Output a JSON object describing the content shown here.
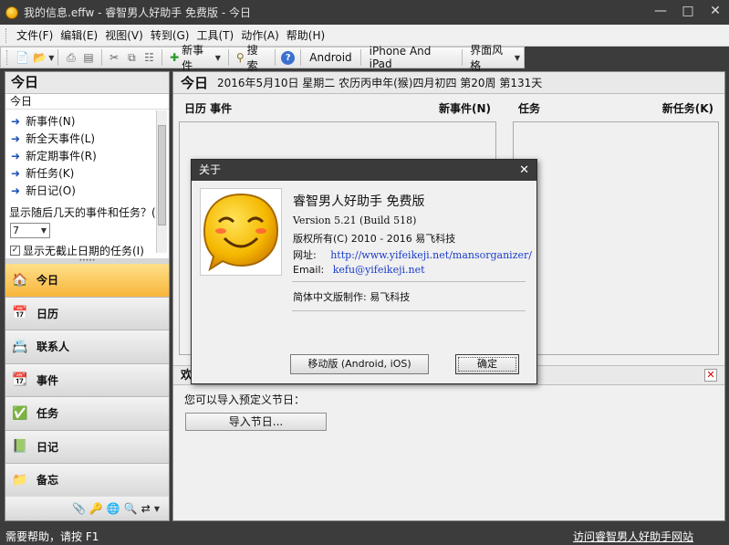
{
  "window": {
    "title": "我的信息.effw - 睿智男人好助手 免费版 - 今日"
  },
  "menu": [
    "文件(F)",
    "编辑(E)",
    "视图(V)",
    "转到(G)",
    "工具(T)",
    "动作(A)",
    "帮助(H)"
  ],
  "toolbar": {
    "new_event": "新事件",
    "search": "搜索",
    "android": "Android",
    "iphone": "iPhone And iPad",
    "theme": "界面风格"
  },
  "left": {
    "header": "今日",
    "sub": "今日",
    "links": [
      "新事件(N)",
      "新全天事件(L)",
      "新定期事件(R)",
      "新任务(K)",
      "新日记(O)"
    ],
    "days_label": "显示随后几天的事件和任务？(S)",
    "days_value": "7",
    "show_overdue": "显示无截止日期的任务(I)",
    "nav": [
      "今日",
      "日历",
      "联系人",
      "事件",
      "任务",
      "日记",
      "备忘"
    ]
  },
  "main": {
    "title": "今日",
    "date_info": "2016年5月10日 星期二 农历丙申年(猴)四月初四 第20周 第131天",
    "left_section_title": "日历 事件",
    "left_section_action": "新事件(N)",
    "right_section_title": "任务",
    "right_section_action": "新任务(K)",
    "holiday_title": "欢",
    "import_label": "您可以导入预定义节日：",
    "import_button": "导入节日..."
  },
  "status": {
    "left": "需要帮助，请按 F1",
    "right": "访问睿智男人好助手网站"
  },
  "dialog": {
    "title": "关于",
    "product": "睿智男人好助手 免费版",
    "version": "Version 5.21 (Build 518)",
    "copyright": "版权所有(C) 2010 - 2016 易飞科技",
    "website_label": "网址:",
    "website": "http://www.yifeikeji.net/mansorganizer/",
    "email_label": "Email:",
    "email": "kefu@yifeikeji.net",
    "localized": "简体中文版制作: 易飞科技",
    "mobile_button": "移动版 (Android, iOS)",
    "ok_button": "确定"
  },
  "colors": {
    "active_nav": "#f7b53a",
    "link": "#1a3cc8",
    "close_x": "#cc0000"
  }
}
